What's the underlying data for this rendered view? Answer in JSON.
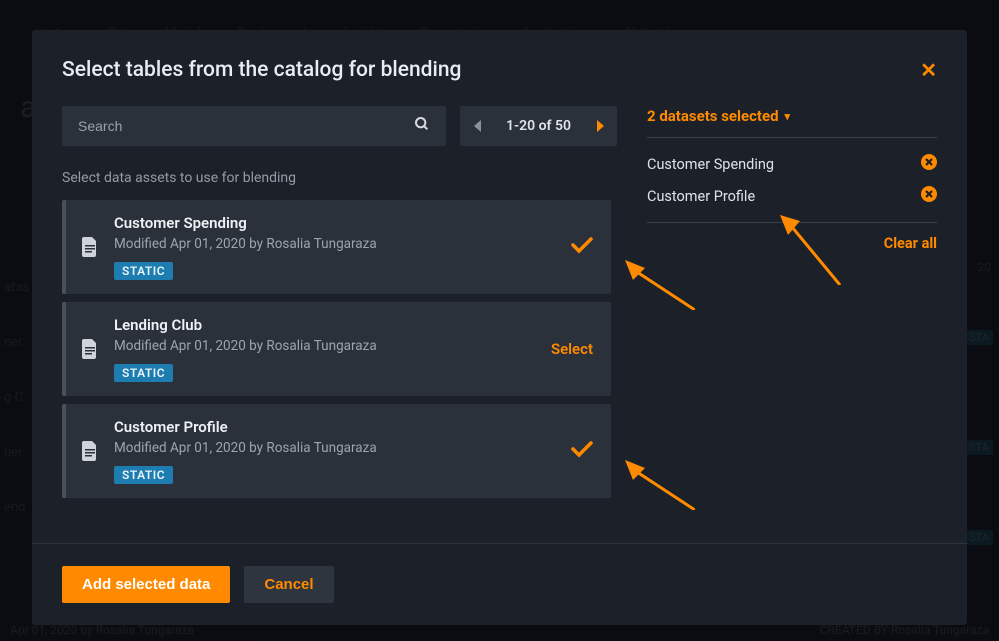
{
  "bg": {
    "logo": "Robot",
    "nav": [
      "Data",
      "Models",
      "Deployments",
      "Insights",
      "Repositories",
      "Applications",
      "AI Catalog"
    ],
    "title_frag": "at",
    "footer_left": "Apr 01, 2020 by Rosalia Tungaraza",
    "footer_right_label": "CREATED BY",
    "footer_right_value": "Rosalia Tungaraza",
    "side": [
      "atas",
      "ner",
      "g C",
      "ner",
      "end"
    ],
    "badge": "STA",
    "datestamp": "20"
  },
  "modal": {
    "title": "Select tables from the catalog for blending",
    "search_placeholder": "Search",
    "pager_text": "1-20 of 50",
    "instruction": "Select data assets to use for blending",
    "assets": [
      {
        "name": "Customer Spending",
        "meta": "Modified Apr 01, 2020 by Rosalia Tungaraza",
        "tag": "STATIC",
        "selected": true
      },
      {
        "name": "Lending Club",
        "meta": "Modified Apr 01, 2020 by Rosalia Tungaraza",
        "tag": "STATIC",
        "selected": false,
        "action_label": "Select"
      },
      {
        "name": "Customer Profile",
        "meta": "Modified Apr 01, 2020 by Rosalia Tungaraza",
        "tag": "STATIC",
        "selected": true
      }
    ],
    "selected_header": "2 datasets selected",
    "selected": [
      {
        "name": "Customer Spending"
      },
      {
        "name": "Customer Profile"
      }
    ],
    "clear_all": "Clear all",
    "add_button": "Add selected data",
    "cancel_button": "Cancel"
  }
}
